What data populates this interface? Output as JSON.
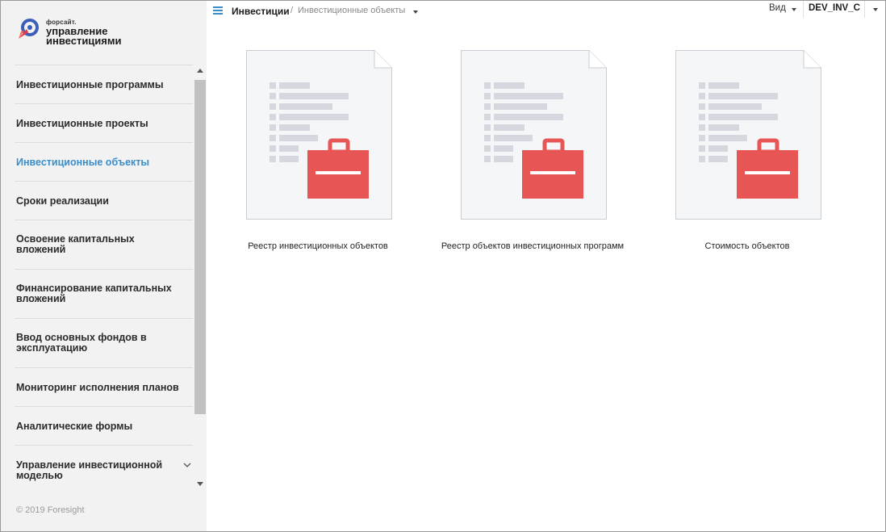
{
  "logo": {
    "small": "форсайт.",
    "line1": "управление",
    "line2": "инвестициями"
  },
  "sidebar": {
    "items": [
      {
        "label": "Инвестиционные программы"
      },
      {
        "label": "Инвестиционные проекты"
      },
      {
        "label": "Инвестиционные объекты"
      },
      {
        "label": "Сроки реализации"
      },
      {
        "label": "Освоение капитальных вложений"
      },
      {
        "label": "Финансирование капитальных вложений"
      },
      {
        "label": "Ввод основных фондов в эксплуатацию"
      },
      {
        "label": "Мониторинг исполнения планов"
      },
      {
        "label": "Аналитические формы"
      },
      {
        "label": "Управление инвестиционной моделью"
      }
    ],
    "active_index": 2,
    "copyright": "© 2019 Foresight"
  },
  "header": {
    "breadcrumb_root": "Инвестиции",
    "breadcrumb_separator": "/",
    "breadcrumb_current": "Инвестиционные объекты",
    "view_label": "Вид",
    "user": "DEV_INV_C"
  },
  "tiles": [
    {
      "label": "Реестр инвестиционных объектов",
      "icon": "briefcase-report-icon"
    },
    {
      "label": "Реестр объектов инвестиционных программ",
      "icon": "briefcase-report-icon"
    },
    {
      "label": "Стоимость объектов",
      "icon": "briefcase-report-icon"
    }
  ],
  "colors": {
    "accent": "#3b8ec9",
    "briefcase": "#e85555",
    "sidebar_bg": "#f2f2f2",
    "doc_bg": "#f5f6f8",
    "doc_lines": "#d5d8de"
  }
}
